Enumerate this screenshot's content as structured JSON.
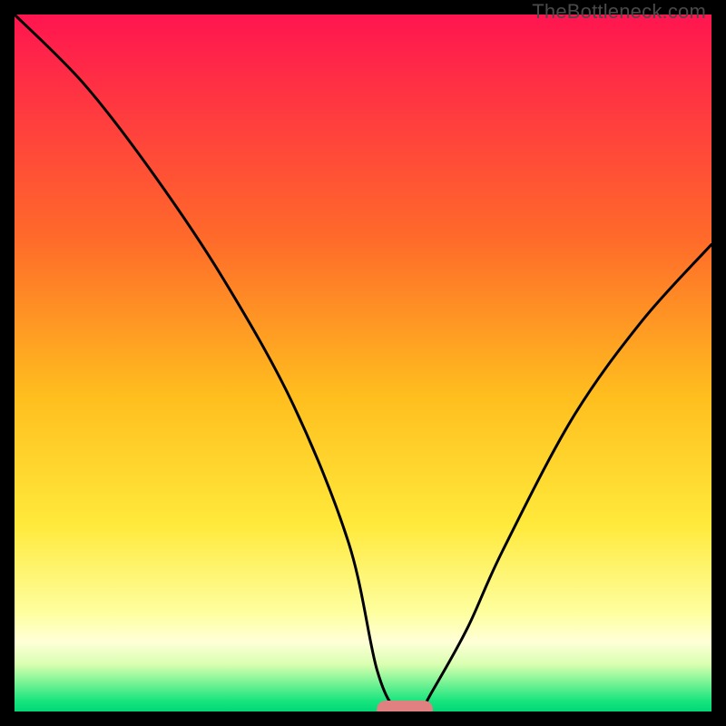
{
  "watermark": "TheBottleneck.com",
  "chart_data": {
    "type": "line",
    "title": "",
    "xlabel": "",
    "ylabel": "",
    "xlim": [
      0,
      100
    ],
    "ylim": [
      0,
      100
    ],
    "x": [
      0,
      10,
      20,
      30,
      40,
      48,
      52,
      55,
      58,
      60,
      65,
      70,
      80,
      90,
      100
    ],
    "values": [
      100,
      90,
      77,
      62,
      44,
      24,
      6,
      0,
      0,
      3,
      12,
      23,
      42,
      56,
      67
    ],
    "marker": {
      "x": 56,
      "y": 0,
      "color": "#e08080"
    },
    "gradient_stops": [
      {
        "offset": 0,
        "color": "#ff1550"
      },
      {
        "offset": 0.32,
        "color": "#ff6a2a"
      },
      {
        "offset": 0.55,
        "color": "#ffbf1e"
      },
      {
        "offset": 0.73,
        "color": "#ffe93a"
      },
      {
        "offset": 0.86,
        "color": "#feffa0"
      },
      {
        "offset": 0.9,
        "color": "#ffffd8"
      },
      {
        "offset": 0.933,
        "color": "#d8ffb0"
      },
      {
        "offset": 0.955,
        "color": "#86f598"
      },
      {
        "offset": 0.985,
        "color": "#18e47e"
      },
      {
        "offset": 1.0,
        "color": "#00d877"
      }
    ]
  }
}
